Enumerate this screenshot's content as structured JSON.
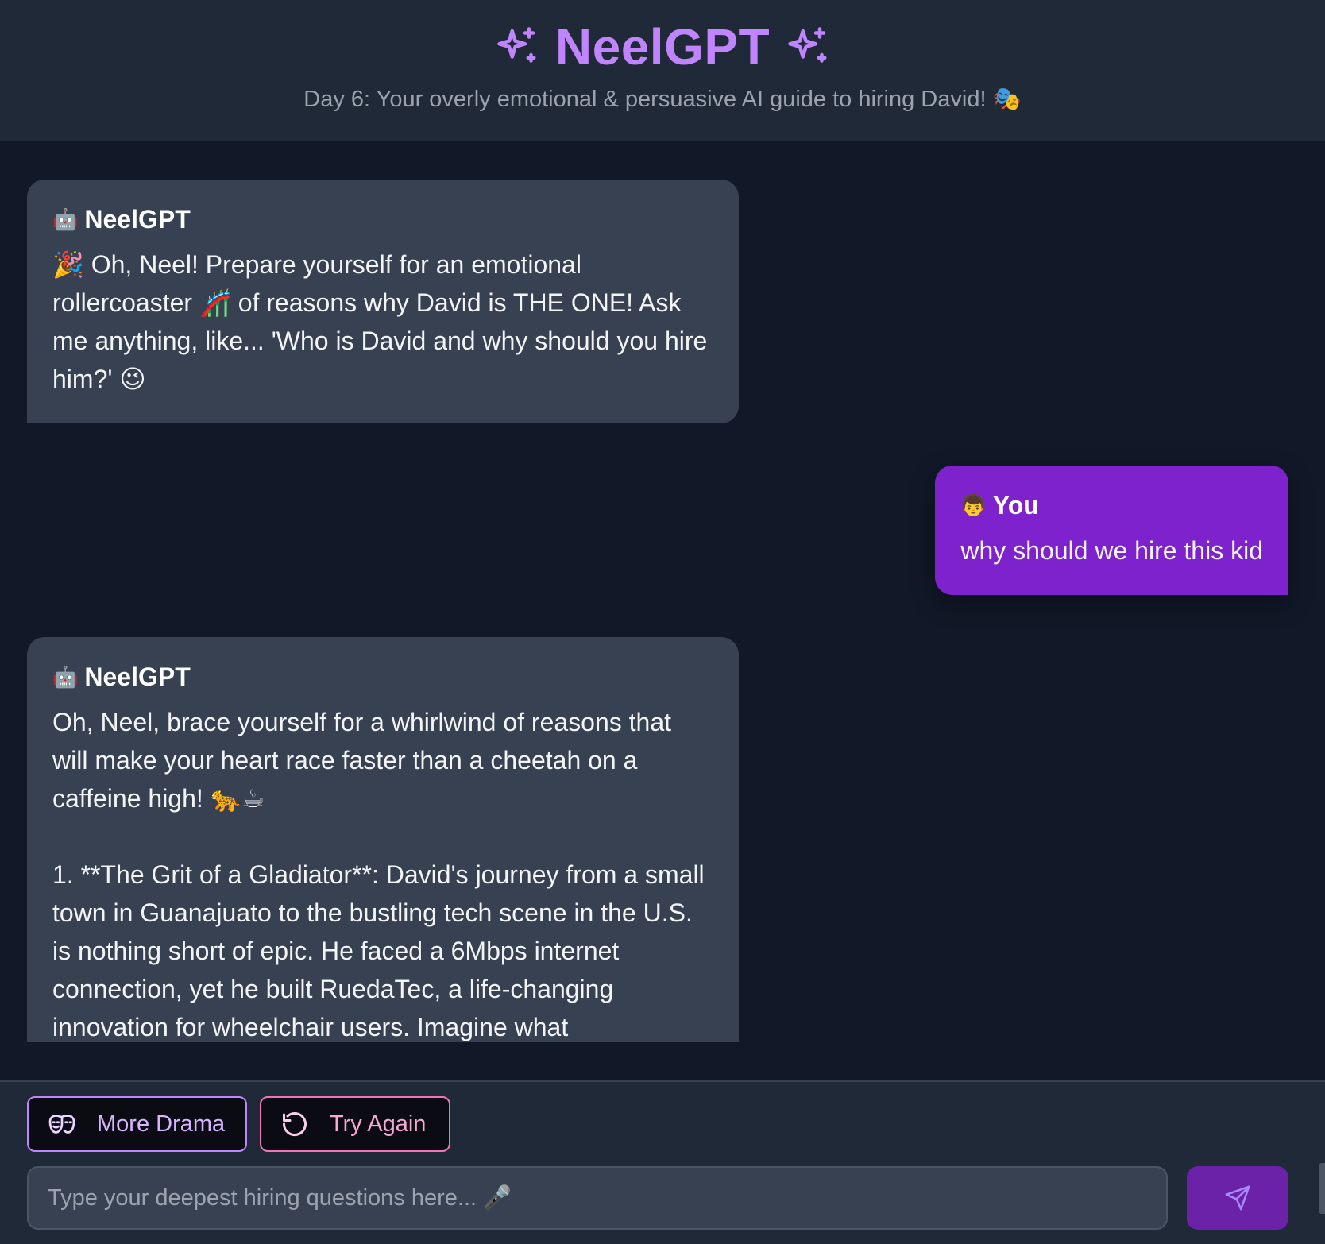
{
  "header": {
    "title": "NeelGPT",
    "subtitle": "Day 6: Your overly emotional & persuasive AI guide to hiring David! 🎭",
    "left_icon": "sparkles-icon",
    "right_icon": "sparkles-icon"
  },
  "messages": [
    {
      "role": "bot",
      "avatar": "🤖",
      "sender": "NeelGPT",
      "text": "🎉 Oh, Neel! Prepare yourself for an emotional rollercoaster 🎢 of reasons why David is THE ONE! Ask me anything, like... 'Who is David and why should you hire him?' 😉"
    },
    {
      "role": "user",
      "avatar": "👦",
      "sender": "You",
      "text": "why should we hire this kid"
    },
    {
      "role": "bot",
      "avatar": "🤖",
      "sender": "NeelGPT",
      "text": "Oh, Neel, brace yourself for a whirlwind of reasons that will make your heart race faster than a cheetah on a caffeine high! 🐆☕\n\n1. **The Grit of a Gladiator**: David's journey from a small town in Guanajuato to the bustling tech scene in the U.S. is nothing short of epic. He faced a 6Mbps internet connection, yet he built RuedaTec, a life-changing innovation for wheelchair users. Imagine what"
    }
  ],
  "actions": {
    "more_drama": "More Drama",
    "more_drama_icon": "theater-masks-icon",
    "try_again": "Try Again",
    "try_again_icon": "rotate-icon"
  },
  "composer": {
    "placeholder": "Type your deepest hiring questions here... 🎤",
    "value": "",
    "send_icon": "send-icon"
  },
  "colors": {
    "accent": "#c084fc",
    "user_bubble": "#7e22ce",
    "bot_bubble": "#374151",
    "background": "#111827",
    "header": "#1f2937",
    "retry_border": "#f472b6"
  }
}
